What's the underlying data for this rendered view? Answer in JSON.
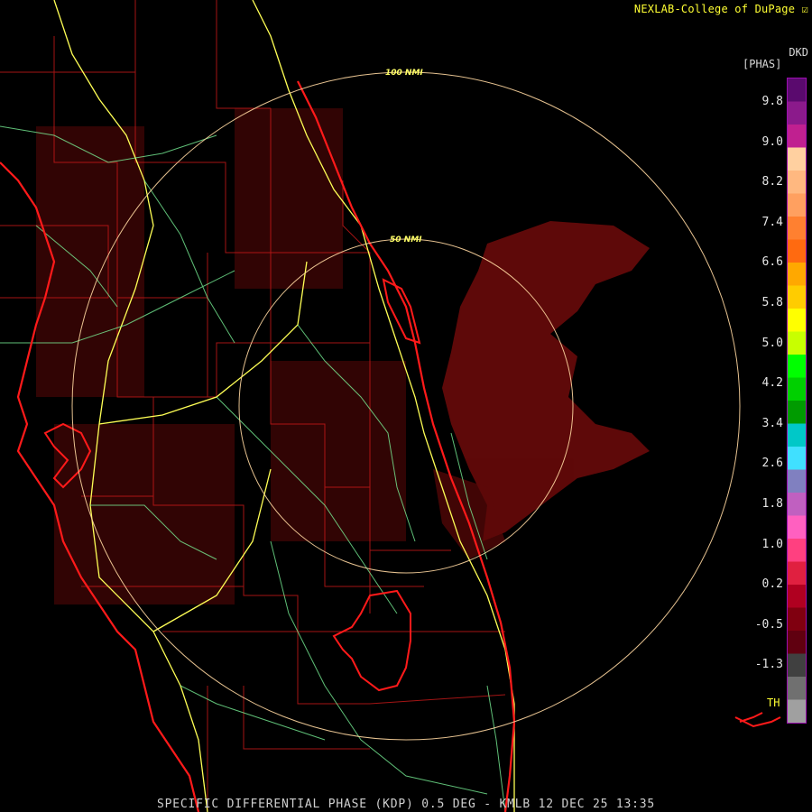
{
  "header": {
    "credit": "NEXLAB-College of DuPage"
  },
  "footer": {
    "caption": "SPECIFIC DIFFERENTIAL PHASE (KDP) 0.5 DEG - KMLB 12 DEC 25 13:35"
  },
  "legend": {
    "product": "DKD",
    "unit": "[PHAS]",
    "ticks": [
      "9.8",
      "9.0",
      "8.2",
      "7.4",
      "6.6",
      "5.8",
      "5.0",
      "4.2",
      "3.4",
      "2.6",
      "1.8",
      "1.0",
      "0.2",
      "-0.5",
      "-1.3"
    ],
    "threshold_label": "TH",
    "colors": [
      "#5a0a6e",
      "#8b1a8b",
      "#c02090",
      "#ffd0a0",
      "#ffb880",
      "#ffa060",
      "#ff8030",
      "#ff6a10",
      "#ffa800",
      "#ffcc00",
      "#ffff00",
      "#c8ff00",
      "#00ff00",
      "#00d000",
      "#009b00",
      "#00c8c8",
      "#40e0ff",
      "#8080c0",
      "#c060c0",
      "#ff60c0",
      "#ff4080",
      "#e02040",
      "#b00020",
      "#800010",
      "#600010",
      "#404040",
      "#707070",
      "#a0a0a0"
    ]
  },
  "rings": [
    {
      "label": "100 NMI"
    },
    {
      "label": "50 NMI"
    }
  ],
  "colors": {
    "coast": "#ff1a1a",
    "county": "#cc1a1a",
    "road_major": "#ffff55",
    "road_minor": "#7fff9f",
    "ring": "#ffd7a0",
    "echo": "#6e0a0a"
  }
}
